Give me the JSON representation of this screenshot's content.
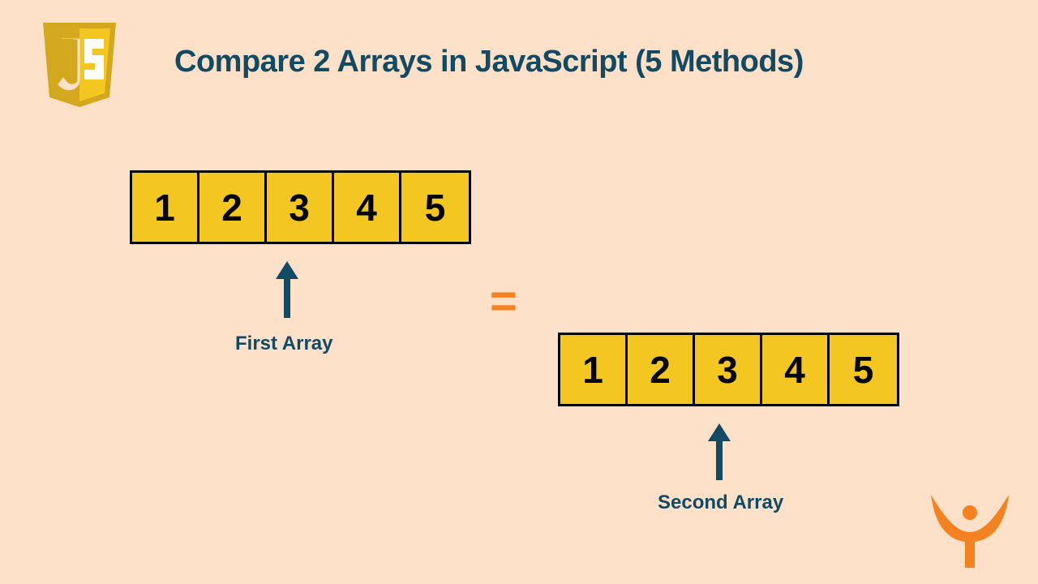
{
  "title": "Compare 2 Arrays in JavaScript (5 Methods)",
  "array1": {
    "cells": [
      "1",
      "2",
      "3",
      "4",
      "5"
    ],
    "label": "First Array"
  },
  "array2": {
    "cells": [
      "1",
      "2",
      "3",
      "4",
      "5"
    ],
    "label": "Second Array"
  },
  "equals": "=",
  "colors": {
    "bg": "#fce0c8",
    "cell": "#f3c622",
    "text": "#134a63",
    "accent": "#f58220"
  }
}
